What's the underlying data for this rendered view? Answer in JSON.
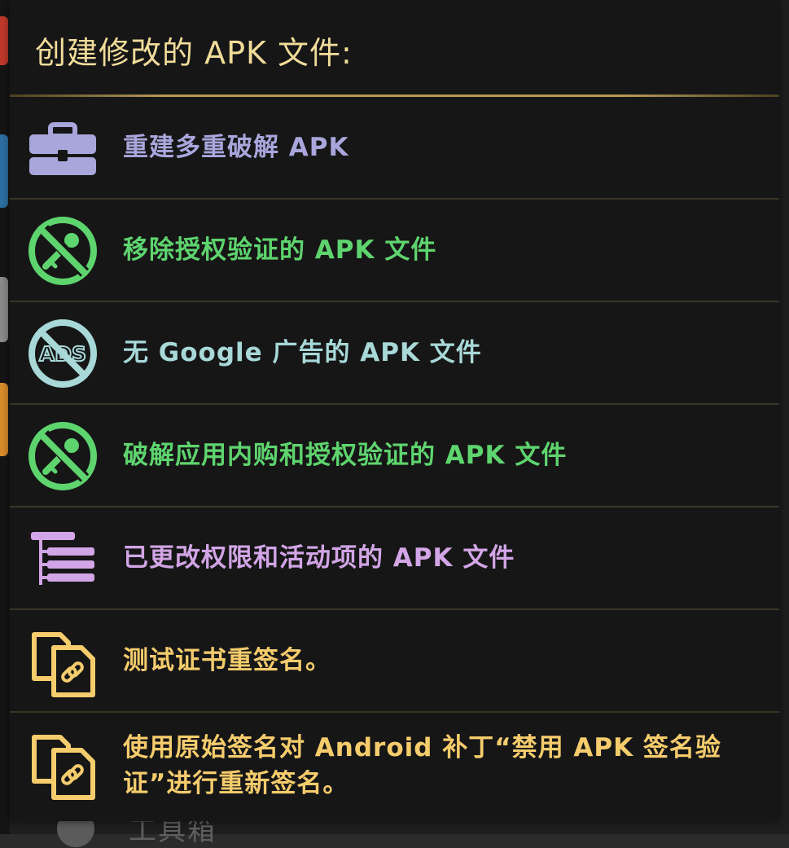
{
  "dialog": {
    "title": "创建修改的 APK 文件:"
  },
  "colors": {
    "title": "#f2dc9a",
    "purple_blue": "#a9a6dc",
    "green": "#5ed46e",
    "teal": "#a8d8d8",
    "orchid": "#d2a5e6",
    "gold": "#f6cc6c"
  },
  "menu": {
    "items": [
      {
        "label": "重建多重破解 APK",
        "icon": "toolbox-icon",
        "color": "#a9a6dc"
      },
      {
        "label": "移除授权验证的 APK 文件",
        "icon": "no-key-icon",
        "color": "#5ed46e"
      },
      {
        "label": "无 Google 广告的 APK 文件",
        "icon": "no-ads-icon",
        "color": "#a8d8d8"
      },
      {
        "label": "破解应用内购和授权验证的 APK 文件",
        "icon": "no-key-icon",
        "color": "#5ed46e"
      },
      {
        "label": "已更改权限和活动项的 APK 文件",
        "icon": "tree-list-icon",
        "color": "#d2a5e6"
      },
      {
        "label": "测试证书重签名。",
        "icon": "linked-documents-icon",
        "color": "#f6cc6c"
      },
      {
        "label": "使用原始签名对 Android 补丁“禁用 APK 签名验证”进行重新签名。",
        "icon": "linked-documents-icon",
        "color": "#f6cc6c"
      }
    ]
  },
  "background": {
    "partial_text": "工具箱"
  }
}
